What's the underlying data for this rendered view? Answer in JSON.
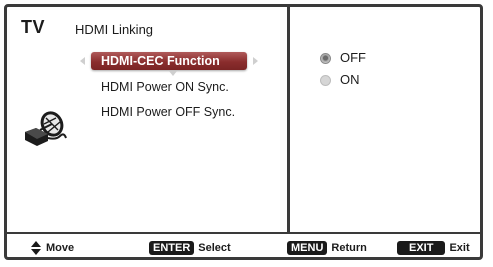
{
  "header": {
    "tv_label": "TV",
    "menu_title": "HDMI Linking"
  },
  "menu": {
    "items": [
      {
        "label": "HDMI-CEC Function"
      },
      {
        "label": "HDMI Power ON Sync."
      },
      {
        "label": "HDMI Power OFF Sync."
      }
    ]
  },
  "options": {
    "items": [
      {
        "label": "OFF",
        "checked": true
      },
      {
        "label": "ON",
        "checked": false
      }
    ]
  },
  "footer": {
    "move_label": "Move",
    "enter_key": "ENTER",
    "enter_label": "Select",
    "menu_key": "MENU",
    "menu_label": "Return",
    "exit_key": "EXIT",
    "exit_label": "Exit"
  },
  "colors": {
    "highlight": "#8a2d2d",
    "frame": "#3a3a3a"
  }
}
